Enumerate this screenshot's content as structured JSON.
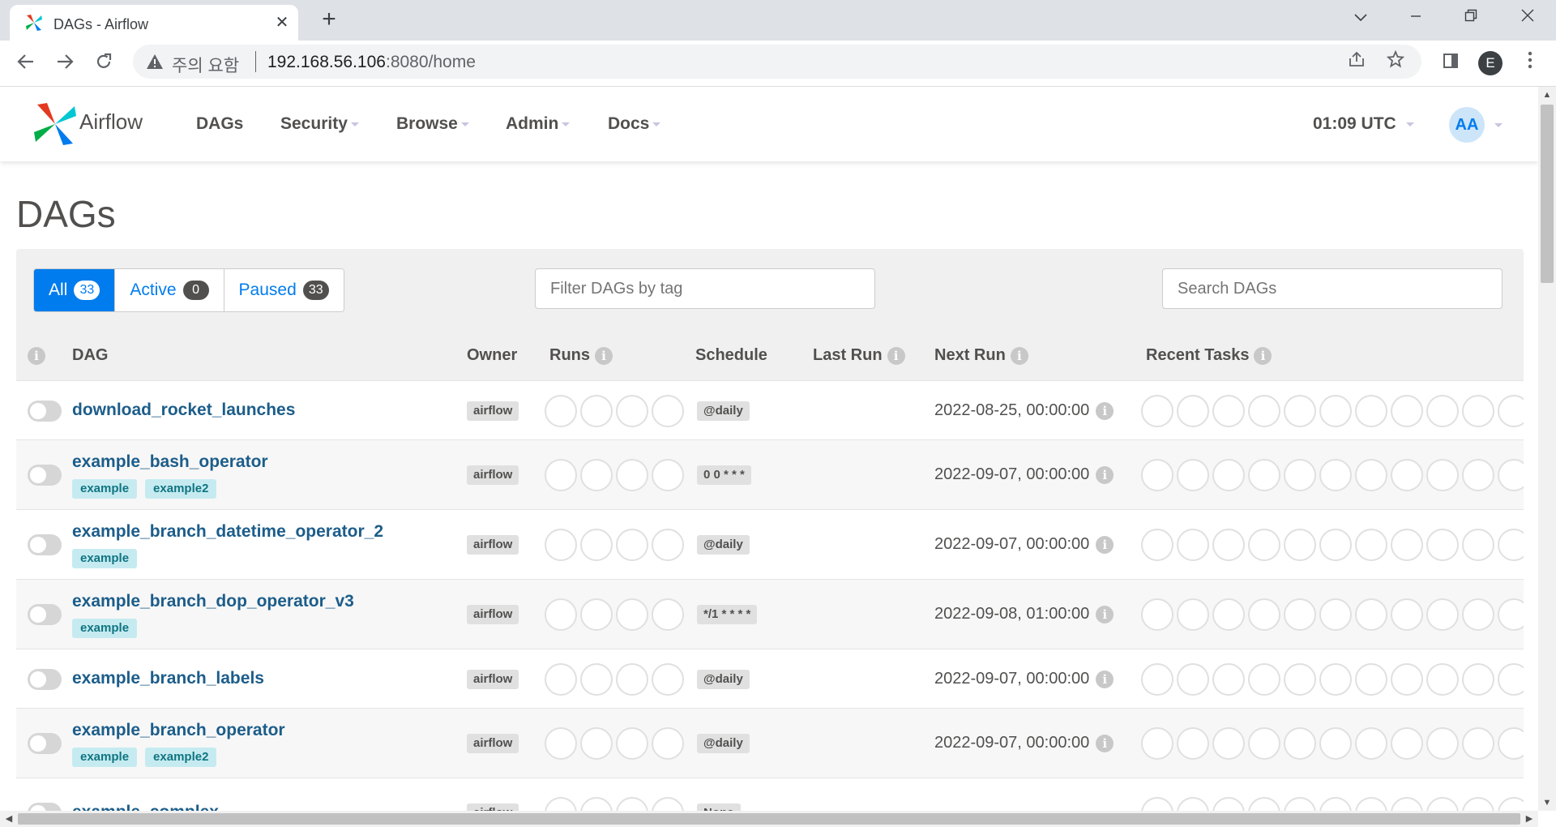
{
  "browser": {
    "tab_title": "DAGs - Airflow",
    "tab_close": "✕",
    "new_tab": "+",
    "security_label": "주의 요함",
    "url_host": "192.168.56.106",
    "url_rest": ":8080/home",
    "profile_initial": "E"
  },
  "navbar": {
    "brand": "Airflow",
    "links": [
      "DAGs",
      "Security",
      "Browse",
      "Admin",
      "Docs"
    ],
    "clock": "01:09 UTC",
    "avatar": "AA"
  },
  "page": {
    "title": "DAGs",
    "filters": {
      "all_label": "All",
      "all_count": "33",
      "active_label": "Active",
      "active_count": "0",
      "paused_label": "Paused",
      "paused_count": "33"
    },
    "tag_filter_placeholder": "Filter DAGs by tag",
    "search_placeholder": "Search DAGs"
  },
  "table": {
    "columns": {
      "info": "i",
      "dag": "DAG",
      "owner": "Owner",
      "runs": "Runs",
      "schedule": "Schedule",
      "last_run": "Last Run",
      "next_run": "Next Run",
      "recent_tasks": "Recent Tasks"
    },
    "rows": [
      {
        "name": "download_rocket_launches",
        "tags": [],
        "owner": "airflow",
        "schedule": "@daily",
        "next_run": "2022-08-25, 00:00:00"
      },
      {
        "name": "example_bash_operator",
        "tags": [
          "example",
          "example2"
        ],
        "owner": "airflow",
        "schedule": "0 0 * * *",
        "next_run": "2022-09-07, 00:00:00"
      },
      {
        "name": "example_branch_datetime_operator_2",
        "tags": [
          "example"
        ],
        "owner": "airflow",
        "schedule": "@daily",
        "next_run": "2022-09-07, 00:00:00"
      },
      {
        "name": "example_branch_dop_operator_v3",
        "tags": [
          "example"
        ],
        "owner": "airflow",
        "schedule": "*/1 * * * *",
        "next_run": "2022-09-08, 01:00:00"
      },
      {
        "name": "example_branch_labels",
        "tags": [],
        "owner": "airflow",
        "schedule": "@daily",
        "next_run": "2022-09-07, 00:00:00"
      },
      {
        "name": "example_branch_operator",
        "tags": [
          "example",
          "example2"
        ],
        "owner": "airflow",
        "schedule": "@daily",
        "next_run": "2022-09-07, 00:00:00"
      },
      {
        "name": "example_complex",
        "tags": [],
        "owner": "airflow",
        "schedule": "None",
        "next_run": ""
      }
    ]
  },
  "colors": {
    "brand_blue": "#017cee",
    "link": "#1c5d8a",
    "tag_bg": "#c5ebf1",
    "tag_text": "#107481"
  }
}
